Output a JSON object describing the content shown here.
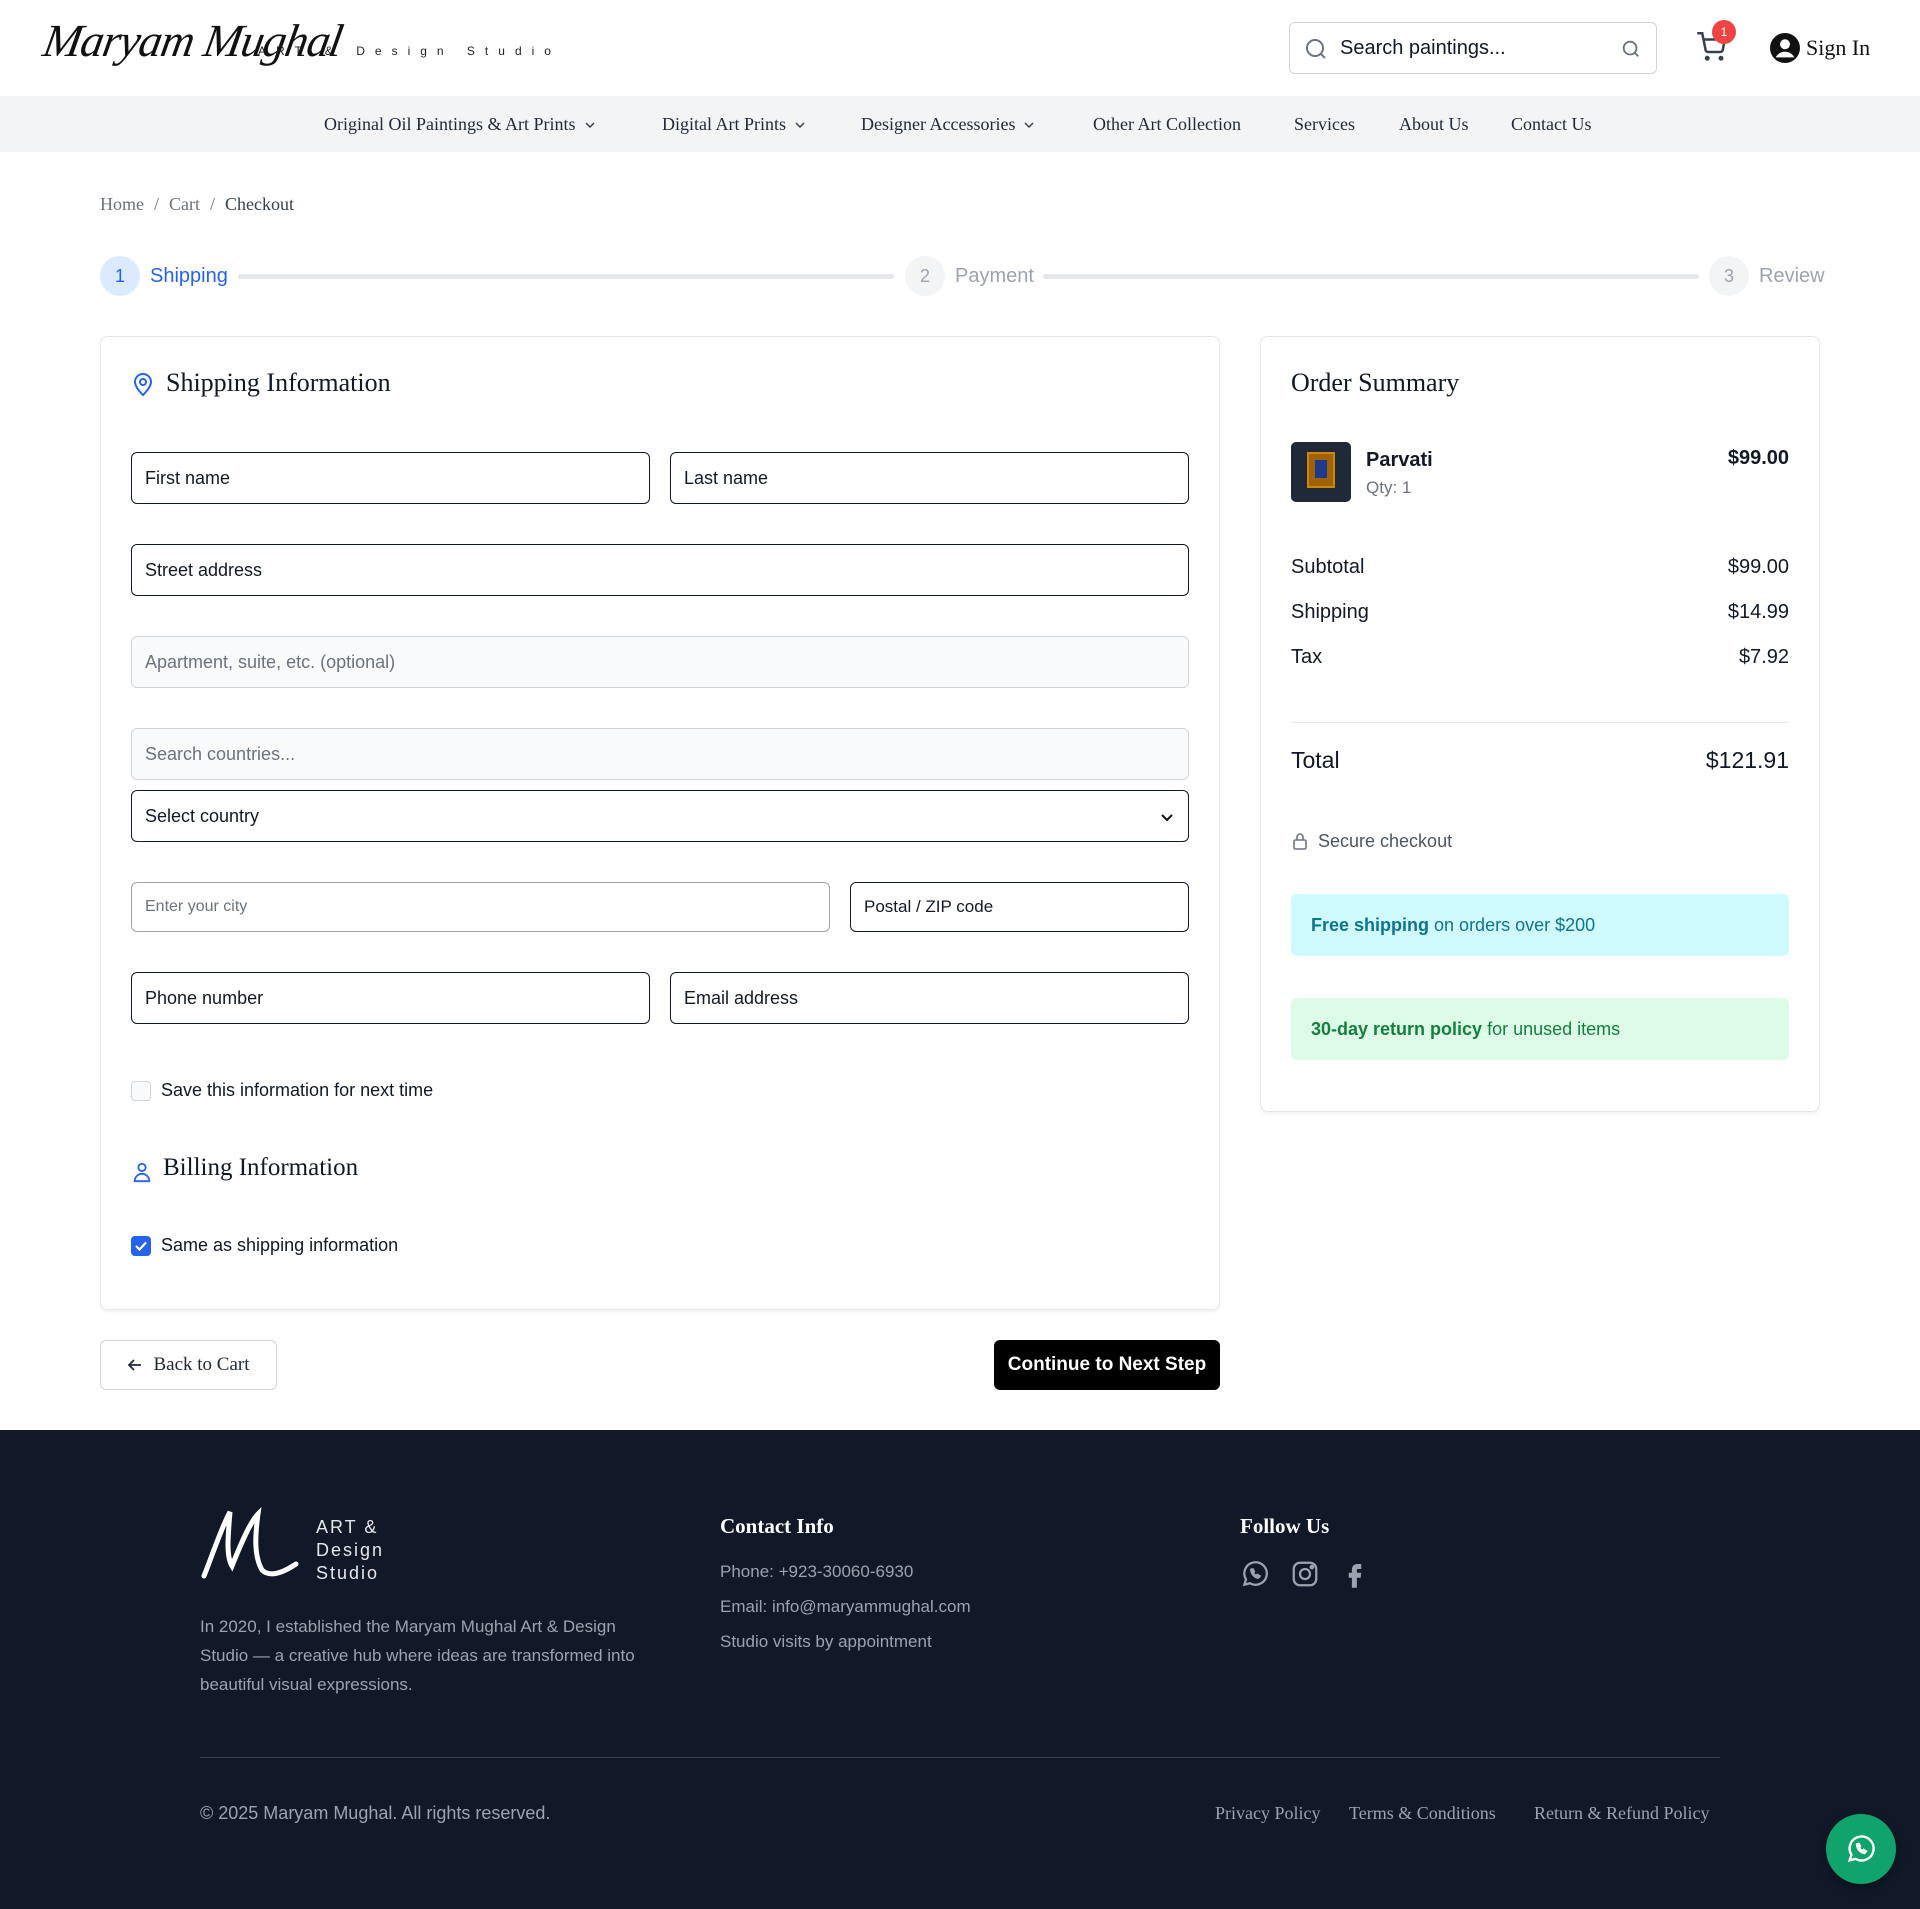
{
  "header": {
    "logo_script": "Maryam Mughal",
    "logo_tagline": "ART & Design Studio",
    "search_placeholder": "Search paintings...",
    "cart_count": "1",
    "sign_in": "Sign In"
  },
  "nav": {
    "items": [
      {
        "label": "Original Oil Paintings & Art Prints",
        "dropdown": true
      },
      {
        "label": "Digital Art Prints",
        "dropdown": true
      },
      {
        "label": "Designer Accessories",
        "dropdown": true
      },
      {
        "label": "Other Art Collection",
        "dropdown": false
      },
      {
        "label": "Services",
        "dropdown": false
      },
      {
        "label": "About Us",
        "dropdown": false
      },
      {
        "label": "Contact Us",
        "dropdown": false
      }
    ]
  },
  "breadcrumb": {
    "items": [
      "Home",
      "Cart",
      "Checkout"
    ],
    "separator": "/"
  },
  "stepper": {
    "steps": [
      {
        "number": "1",
        "label": "Shipping",
        "state": "active"
      },
      {
        "number": "2",
        "label": "Payment",
        "state": "inactive"
      },
      {
        "number": "3",
        "label": "Review",
        "state": "inactive"
      }
    ]
  },
  "shipping": {
    "title": "Shipping Information",
    "fields": {
      "first_name": "First name",
      "last_name": "Last name",
      "street": "Street address",
      "apartment": "Apartment, suite, etc. (optional)",
      "country_search": "Search countries...",
      "country_select": "Select country",
      "city": "Enter your city",
      "postal": "Postal / ZIP code",
      "phone": "Phone number",
      "email": "Email address"
    },
    "save_info_label": "Save this information for next time",
    "save_info_checked": false
  },
  "billing": {
    "title": "Billing Information",
    "same_as_shipping_label": "Same as shipping information",
    "same_as_shipping_checked": true
  },
  "actions": {
    "back": "Back to Cart",
    "next": "Continue to Next Step"
  },
  "order_summary": {
    "title": "Order Summary",
    "item": {
      "name": "Parvati",
      "qty": "Qty: 1",
      "price": "$99.00"
    },
    "subtotal_label": "Subtotal",
    "subtotal": "$99.00",
    "shipping_label": "Shipping",
    "shipping": "$14.99",
    "tax_label": "Tax",
    "tax": "$7.92",
    "total_label": "Total",
    "total": "$121.91",
    "secure": "Secure checkout",
    "banner_shipping_bold": "Free shipping",
    "banner_shipping_rest": "on orders over $200",
    "banner_return_bold": "30-day return policy",
    "banner_return_rest": "for unused items"
  },
  "footer": {
    "logo_text": [
      "ART &",
      "Design",
      "Studio"
    ],
    "about": "In 2020, I established the Maryam Mughal Art & Design Studio — a creative hub where ideas are transformed into beautiful visual expressions.",
    "contact_title": "Contact Info",
    "phone": "Phone: +923-30060-6930",
    "email": "Email: info@maryammughal.com",
    "visits": "Studio visits by appointment",
    "follow_title": "Follow Us",
    "social": [
      "whatsapp-icon",
      "instagram-icon",
      "facebook-icon"
    ],
    "copyright": "© 2025 Maryam Mughal. All rights reserved.",
    "links": [
      "Privacy Policy",
      "Terms & Conditions",
      "Return & Refund Policy"
    ]
  },
  "colors": {
    "accent": "#2563eb",
    "footer_bg": "#111827",
    "shipping_banner_bg": "#cffafe",
    "return_banner_bg": "#dcfce7",
    "whatsapp": "#10a36b",
    "badge": "#ef4444"
  }
}
